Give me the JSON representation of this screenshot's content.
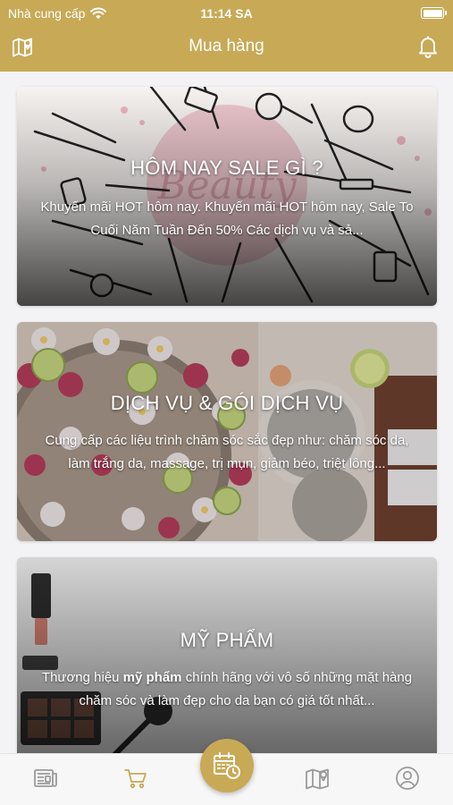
{
  "status_bar": {
    "carrier": "Nhà cung cấp",
    "time": "11:14 SA",
    "wifi_icon": "wifi-icon",
    "battery_icon": "battery-icon"
  },
  "nav": {
    "title": "Mua hàng",
    "left_icon": "map-pin-icon",
    "right_icon": "bell-icon"
  },
  "colors": {
    "brand": "#c8a956",
    "background": "#f3f3f5",
    "tabbar": "#f7f7f7",
    "tab_inactive": "#9a9a9a",
    "tab_active": "#c8a956"
  },
  "cards": [
    {
      "title": "HÔM NAY SALE GÌ ?",
      "desc": "Khuyến mãi HOT hôm nay. Khuyến mãi HOT hôm nay, Sale To Cuối Năm Tuần Đến 50% Các dịch vụ và sả..."
    },
    {
      "title": "DỊCH VỤ & GÓI DỊCH VỤ",
      "desc": "Cung cấp các liệu trình chăm sóc sắc đẹp như: chăm sóc da, làm trắng da, massage, trị mụn, giảm béo, triệt lông..."
    },
    {
      "title": "MỸ PHẨM",
      "desc_before": "Thương hiệu ",
      "desc_bold": "mỹ phẩm",
      "desc_after": " chính hãng với vô số những mặt hàng chăm sóc và làm đẹp cho da bạn có giá tốt nhất..."
    }
  ],
  "tabbar": {
    "items": [
      {
        "icon": "news-icon",
        "active": false
      },
      {
        "icon": "cart-icon",
        "active": true
      },
      {
        "icon": "calendar-clock-icon",
        "active": false
      },
      {
        "icon": "map-icon",
        "active": false
      },
      {
        "icon": "account-icon",
        "active": false
      }
    ]
  }
}
